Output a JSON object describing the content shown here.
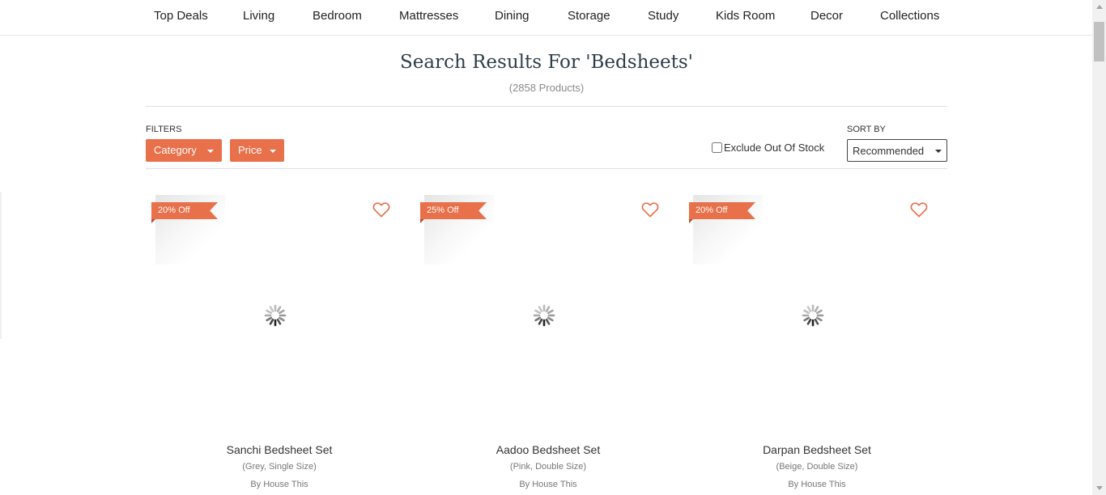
{
  "nav": {
    "items": [
      "Top Deals",
      "Living",
      "Bedroom",
      "Mattresses",
      "Dining",
      "Storage",
      "Study",
      "Kids Room",
      "Decor",
      "Collections"
    ]
  },
  "search": {
    "title": "Search Results For 'Bedsheets'",
    "count": "(2858 Products)"
  },
  "filters": {
    "label": "FILTERS",
    "category": "Category",
    "price": "Price",
    "exclude_out_of_stock": "Exclude Out Of Stock"
  },
  "sort": {
    "label": "SORT BY",
    "selected": "Recommended"
  },
  "products": [
    {
      "discount": "20% Off",
      "name": "Sanchi Bedsheet Set",
      "variant": "(Grey, Single Size)",
      "brand": "By House This"
    },
    {
      "discount": "25% Off",
      "name": "Aadoo Bedsheet Set",
      "variant": "(Pink, Double Size)",
      "brand": "By House This"
    },
    {
      "discount": "20% Off",
      "name": "Darpan Bedsheet Set",
      "variant": "(Beige, Double Size)",
      "brand": "By House This"
    }
  ],
  "colors": {
    "accent": "#e8704a",
    "title": "#2d3e48"
  },
  "icons": {
    "wishlist": "heart-icon",
    "loading": "spinner-icon",
    "dropdown": "caret-down-icon"
  }
}
